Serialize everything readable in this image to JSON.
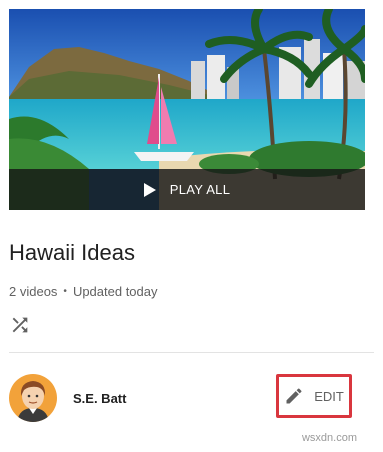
{
  "playlist": {
    "play_all_label": "PLAY ALL",
    "title": "Hawaii Ideas",
    "video_count": "2 videos",
    "separator": "•",
    "updated": "Updated today"
  },
  "owner": {
    "name": "S.E. Batt",
    "edit_label": "EDIT"
  },
  "watermark": "wsxdn.com",
  "icons": [
    "play-icon",
    "shuffle-icon",
    "pencil-icon"
  ],
  "colors": {
    "edit_highlight": "#d9363e",
    "overlay": "#161616",
    "title_text": "#212121",
    "meta_text": "#616161"
  }
}
